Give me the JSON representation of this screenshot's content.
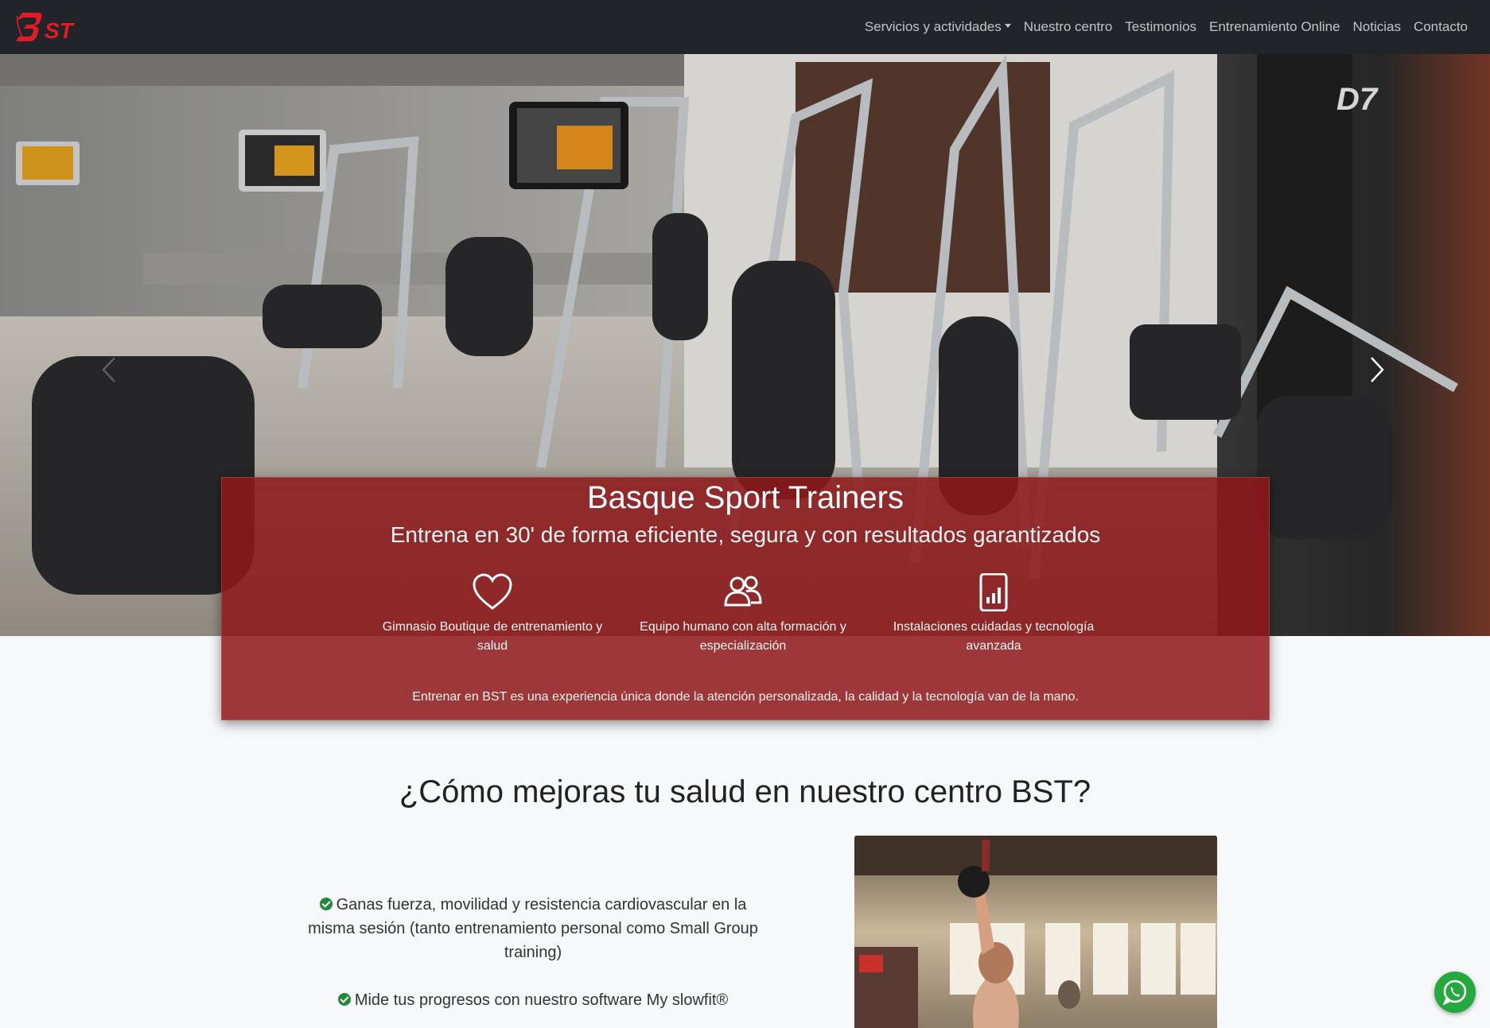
{
  "brand": {
    "logo_text": "3ST",
    "logo_color": "#e31b23"
  },
  "nav": {
    "items": [
      {
        "label": "Servicios y actividades",
        "has_dropdown": true
      },
      {
        "label": "Nuestro centro"
      },
      {
        "label": "Testimonios"
      },
      {
        "label": "Entrenamiento Online"
      },
      {
        "label": "Noticias"
      },
      {
        "label": "Contacto"
      }
    ]
  },
  "hero": {
    "title": "Basque Sport Trainers",
    "subtitle": "Entrena en 30' de forma eficiente, segura y con resultados garantizados",
    "features": [
      {
        "icon": "heart-icon",
        "text": "Gimnasio Boutique de entrenamiento y salud"
      },
      {
        "icon": "people-icon",
        "text": "Equipo humano con alta formación y especialización"
      },
      {
        "icon": "chart-icon",
        "text": "Instalaciones cuidadas y tecnología avanzada"
      }
    ],
    "tagline": "Entrenar en BST es una experiencia única donde la atención personalizada, la calidad y la tecnología van de la mano.",
    "box_color": "#8e171a"
  },
  "section": {
    "title": "¿Cómo mejoras tu salud en nuestro centro BST?",
    "benefits": [
      "Ganas fuerza, movilidad y resistencia cardiovascular en la misma sesión (tanto entrenamiento personal como Small Group training)",
      "Mide tus progresos con nuestro software My slowfit®"
    ]
  },
  "whatsapp": {
    "icon": "whatsapp-icon",
    "color": "#25a93e"
  }
}
